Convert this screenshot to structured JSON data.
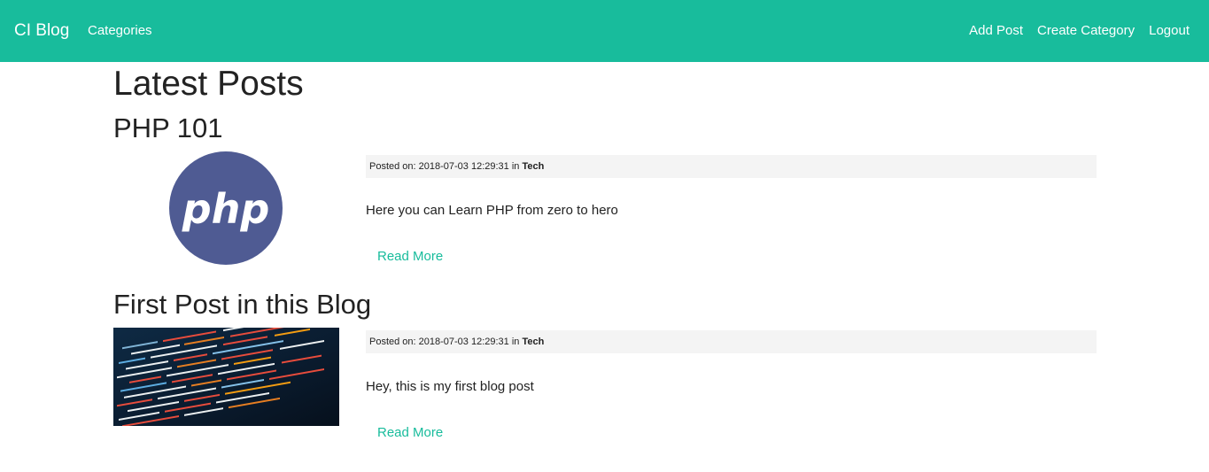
{
  "navbar": {
    "brand": "CI Blog",
    "left_links": [
      "Categories"
    ],
    "right_links": [
      "Add Post",
      "Create Category",
      "Logout"
    ],
    "background_color": "#18bc9c"
  },
  "page": {
    "title": "Latest Posts"
  },
  "posts": [
    {
      "title": "PHP 101",
      "image_icon": "php-logo",
      "meta_prefix": "Posted on: 2018-07-03 12:29:31 in",
      "category": "Tech",
      "body": "Here you can Learn PHP from zero to hero",
      "read_more": "Read More"
    },
    {
      "title": "First Post in this Blog",
      "image_icon": "code-screenshot",
      "meta_prefix": "Posted on: 2018-07-03 12:29:31 in",
      "category": "Tech",
      "body": "Hey, this is my first blog post",
      "read_more": "Read More"
    }
  ],
  "colors": {
    "accent": "#18bc9c",
    "meta_background": "#f4f4f4",
    "php_logo": "#4f5b93"
  }
}
